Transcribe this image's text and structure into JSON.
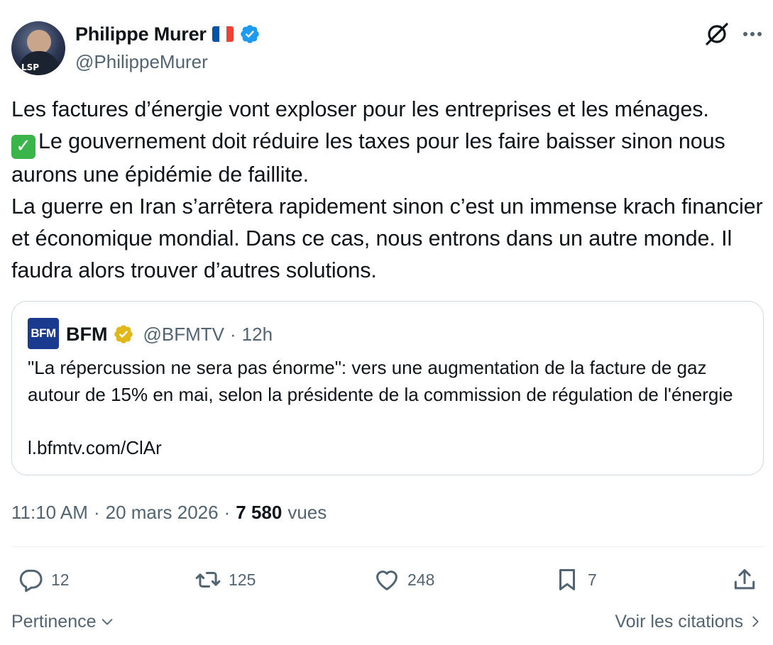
{
  "author": {
    "display_name": "Philippe Murer",
    "handle": "@PhilippeMurer",
    "avatar_caption": "LSP",
    "flag_colors": [
      "#0055a4",
      "#ffffff",
      "#ef4135"
    ],
    "verified_color": "#1d9bf0"
  },
  "tweet": {
    "lines": [
      "Les factures d’énergie vont exploser pour les entreprises et les ménages.",
      "Le gouvernement doit réduire les taxes pour les faire baisser sinon nous aurons une épidémie de faillite.",
      "La guerre en Iran s’arrêtera rapidement sinon c’est un immense krach financier et économique mondial. Dans ce cas, nous entrons dans un autre monde. Il faudra alors trouver d’autres solutions."
    ],
    "check_emoji": "✓"
  },
  "quote": {
    "logo_text": "BFM",
    "name": "BFM",
    "handle": "@BFMTV",
    "separator": "·",
    "time_ago": "12h",
    "text": "\"La répercussion ne sera pas énorme\": vers une augmentation de la facture de gaz autour de 15% en mai, selon la présidente de la commission de régulation de l'énergie",
    "link": "l.bfmtv.com/ClAr",
    "verified_color": "#e2b719"
  },
  "meta": {
    "time": "11:10 AM",
    "sep1": "·",
    "date": "20 mars 2026",
    "sep2": "·",
    "views_count": "7 580",
    "views_label": "vues"
  },
  "actions": {
    "replies": "12",
    "reposts": "125",
    "likes": "248",
    "bookmarks": "7"
  },
  "footer": {
    "sort_label": "Pertinence",
    "quotes_label": "Voir les citations"
  },
  "icons": [
    "grok-icon",
    "more-icon",
    "reply-icon",
    "repost-icon",
    "like-icon",
    "bookmark-icon",
    "share-icon",
    "chevron-down-icon",
    "chevron-right-icon",
    "verified-badge-icon",
    "check-emoji-icon"
  ]
}
